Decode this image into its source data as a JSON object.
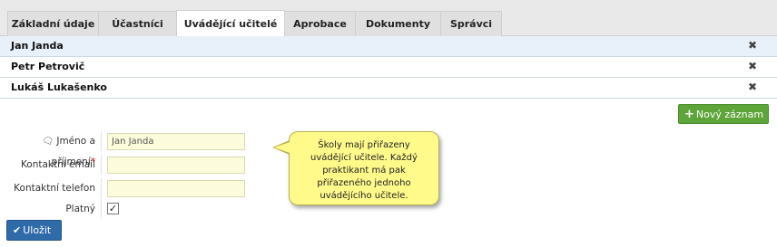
{
  "tabs": [
    "Základní údaje",
    "Účastníci",
    "Uvádějící učitelé",
    "Aprobace",
    "Dokumenty",
    "Správci"
  ],
  "active_tab": "Uvádějící učitelé",
  "teachers": [
    "Jan Janda",
    "Petr Petrovič",
    "Lukáš Lukašenko"
  ],
  "delete_glyph": "✖",
  "new_button": {
    "icon": "plus-icon",
    "label": "Nový záznam"
  },
  "form": {
    "name_label": "Jméno a příjmení",
    "required_mark": "*",
    "name_value": "Jan Janda",
    "email_label": "Kontaktní email",
    "email_value": "",
    "phone_label": "Kontaktní telefon",
    "phone_value": "",
    "valid_label": "Platný",
    "valid_checked": true
  },
  "tooltip_text": "Školy mají přiřazeny uvádějící učitele. Každý praktikant má pak přiřazeného jednoho uvádějícího učitele.",
  "save_button": {
    "icon": "check-icon",
    "label": "Uložit"
  },
  "colors": {
    "new_button": "#5da539",
    "save_button": "#2f6aa9",
    "tooltip": "#fffa8a",
    "field_bg": "#fcfcdc"
  }
}
